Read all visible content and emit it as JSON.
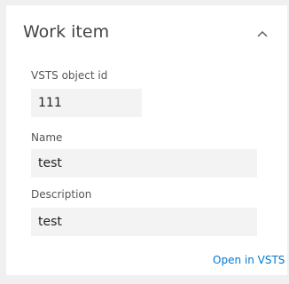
{
  "panel": {
    "title": "Work item",
    "collapse_icon": "chevron-up-icon"
  },
  "fields": {
    "object_id": {
      "label": "VSTS object id",
      "value": "111"
    },
    "name": {
      "label": "Name",
      "value": "test"
    },
    "description": {
      "label": "Description",
      "value": "test"
    }
  },
  "actions": {
    "open_link": "Open in VSTS"
  },
  "colors": {
    "link": "#0078d4",
    "field_bg": "#f3f3f3",
    "page_bg": "#f0f0f0"
  }
}
